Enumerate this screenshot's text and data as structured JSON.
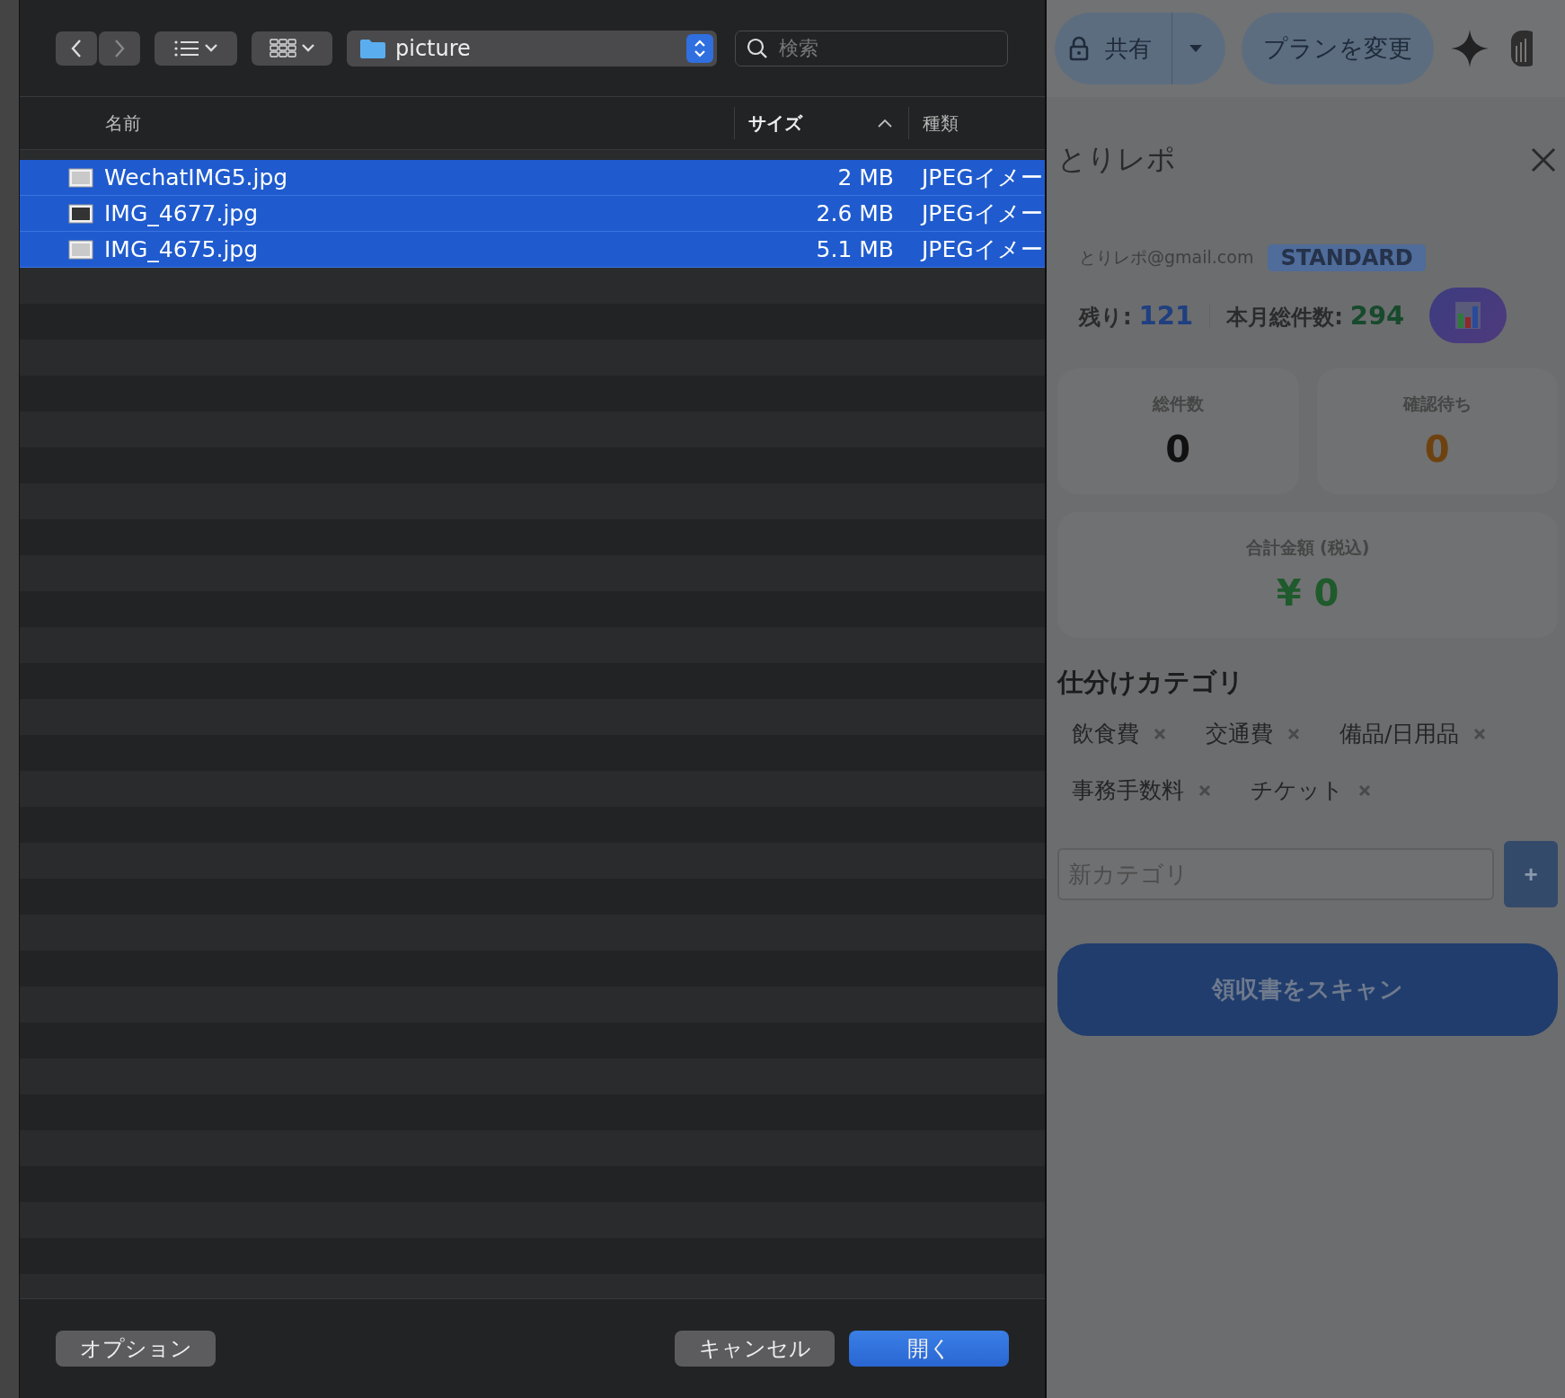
{
  "dialog": {
    "path": {
      "folder": "picture"
    },
    "search": {
      "placeholder": "検索"
    },
    "columns": [
      {
        "label": "名前",
        "sorted": false
      },
      {
        "label": "サイズ",
        "sorted": true
      },
      {
        "label": "種類",
        "sorted": false
      }
    ],
    "files": [
      {
        "name": "WechatIMG5.jpg",
        "size": "2 MB",
        "type": "JPEGイメー",
        "selected": true
      },
      {
        "name": "IMG_4677.jpg",
        "size": "2.6 MB",
        "type": "JPEGイメー",
        "selected": true
      },
      {
        "name": "IMG_4675.jpg",
        "size": "5.1 MB",
        "type": "JPEGイメー",
        "selected": true
      }
    ],
    "buttons": {
      "options": "オプション",
      "cancel": "キャンセル",
      "open": "開く"
    }
  },
  "app": {
    "share": "共有",
    "plan": "プランを変更",
    "title": "とりレポ",
    "email": "とりレポ@gmail.com",
    "badge": "STANDARD",
    "remaining": {
      "label": "残り:",
      "value": "121"
    },
    "monthly": {
      "label": "本月総件数:",
      "value": "294"
    },
    "cards": [
      {
        "label": "総件数",
        "value": "0",
        "color": "#111111"
      },
      {
        "label": "確認待ち",
        "value": "0",
        "color": "#6e4210"
      }
    ],
    "total": {
      "label": "合計金額 (税込)",
      "value": "¥ 0"
    },
    "categories_title": "仕分けカテゴリ",
    "categories": [
      "飲食費",
      "交通費",
      "備品/日用品",
      "事務手数料",
      "チケット"
    ],
    "new_category": {
      "placeholder": "新カテゴリ",
      "add": "+"
    },
    "scan": "領収書をスキャン"
  }
}
